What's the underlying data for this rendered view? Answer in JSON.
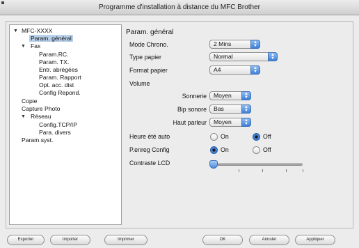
{
  "window": {
    "title": "Programme d'installation à distance du MFC Brother"
  },
  "tree": {
    "items": [
      {
        "label": "MFC-XXXX",
        "level": 0,
        "expanded": true
      },
      {
        "label": "Param. général",
        "level": 1,
        "selected": true
      },
      {
        "label": "Fax",
        "level": 1,
        "expanded": true
      },
      {
        "label": "Param.RC.",
        "level": 2
      },
      {
        "label": "Param. TX.",
        "level": 2
      },
      {
        "label": "Entr. abrégées",
        "level": 2
      },
      {
        "label": "Param. Rapport",
        "level": 2
      },
      {
        "label": "Opt. acc. dist",
        "level": 2
      },
      {
        "label": "Config Repond.",
        "level": 2
      },
      {
        "label": "Copie",
        "level": 1
      },
      {
        "label": "Capture Photo",
        "level": 1
      },
      {
        "label": "Réseau",
        "level": 1,
        "expanded": true
      },
      {
        "label": "Config.TCP/IP",
        "level": 2
      },
      {
        "label": "Para. divers",
        "level": 2
      },
      {
        "label": "Param.syst.",
        "level": 1
      }
    ]
  },
  "panel": {
    "title": "Param. général",
    "mode_chrono": {
      "label": "Mode Chrono.",
      "value": "2 Mins"
    },
    "type_papier": {
      "label": "Type papier",
      "value": "Normal"
    },
    "format_papier": {
      "label": "Format papier",
      "value": "A4"
    },
    "volume": {
      "label": "Volume",
      "sonnerie": {
        "label": "Sonnerie",
        "value": "Moyen"
      },
      "bip": {
        "label": "Bip sonore",
        "value": "Bas"
      },
      "haut_parleur": {
        "label": "Haut parleur",
        "value": "Moyen"
      }
    },
    "heure_ete": {
      "label": "Heure été auto",
      "on": "On",
      "off": "Off",
      "selected": "Off"
    },
    "penreg": {
      "label": "P.enreg Config",
      "on": "On",
      "off": "Off",
      "selected": "On"
    },
    "contraste": {
      "label": "Contraste LCD",
      "level": 0
    }
  },
  "buttons": {
    "exporter": "Exporter",
    "importer": "Importer",
    "imprimer": "Imprimer",
    "ok": "OK",
    "annuler": "Annuler",
    "appliquer": "Appliquer"
  },
  "colors": {
    "accent": "#3f7fd6",
    "selection": "#b9d0ea"
  }
}
